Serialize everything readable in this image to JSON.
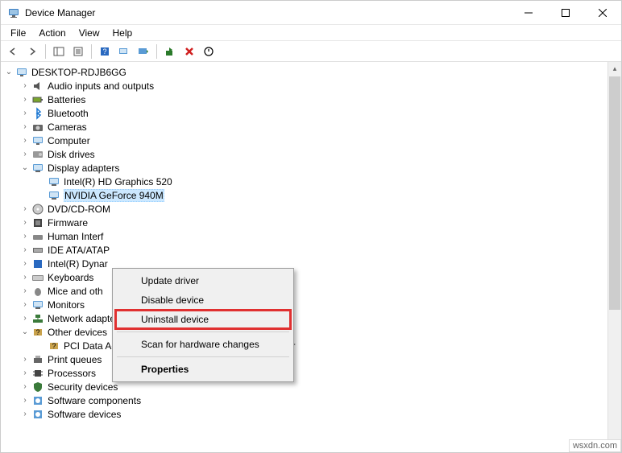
{
  "window": {
    "title": "Device Manager"
  },
  "menu": {
    "file": "File",
    "action": "Action",
    "view": "View",
    "help": "Help"
  },
  "tree": {
    "root": "DESKTOP-RDJB6GG",
    "nodes": [
      {
        "label": "Audio inputs and outputs",
        "exp": ">"
      },
      {
        "label": "Batteries",
        "exp": ">"
      },
      {
        "label": "Bluetooth",
        "exp": ">"
      },
      {
        "label": "Cameras",
        "exp": ">"
      },
      {
        "label": "Computer",
        "exp": ">"
      },
      {
        "label": "Disk drives",
        "exp": ">"
      },
      {
        "label": "Display adapters",
        "exp": "v",
        "children": [
          {
            "label": "Intel(R) HD Graphics 520"
          },
          {
            "label": "NVIDIA GeForce 940M",
            "selected": true
          }
        ]
      },
      {
        "label": "DVD/CD-ROM",
        "exp": ">"
      },
      {
        "label": "Firmware",
        "exp": ">"
      },
      {
        "label": "Human Interf",
        "exp": ">"
      },
      {
        "label": "IDE ATA/ATAP",
        "exp": ">"
      },
      {
        "label": "Intel(R) Dynar",
        "exp": ">"
      },
      {
        "label": "Keyboards",
        "exp": ">"
      },
      {
        "label": "Mice and oth",
        "exp": ">"
      },
      {
        "label": "Monitors",
        "exp": ">"
      },
      {
        "label": "Network adapters",
        "exp": ">"
      },
      {
        "label": "Other devices",
        "exp": "v",
        "children": [
          {
            "label": "PCI Data Acquisition and Signal Processing Controller"
          }
        ]
      },
      {
        "label": "Print queues",
        "exp": ">"
      },
      {
        "label": "Processors",
        "exp": ">"
      },
      {
        "label": "Security devices",
        "exp": ">"
      },
      {
        "label": "Software components",
        "exp": ">"
      },
      {
        "label": "Software devices",
        "exp": ">"
      }
    ]
  },
  "context_menu": {
    "update": "Update driver",
    "disable": "Disable device",
    "uninstall": "Uninstall device",
    "scan": "Scan for hardware changes",
    "properties": "Properties"
  },
  "watermark": "wsxdn.com"
}
